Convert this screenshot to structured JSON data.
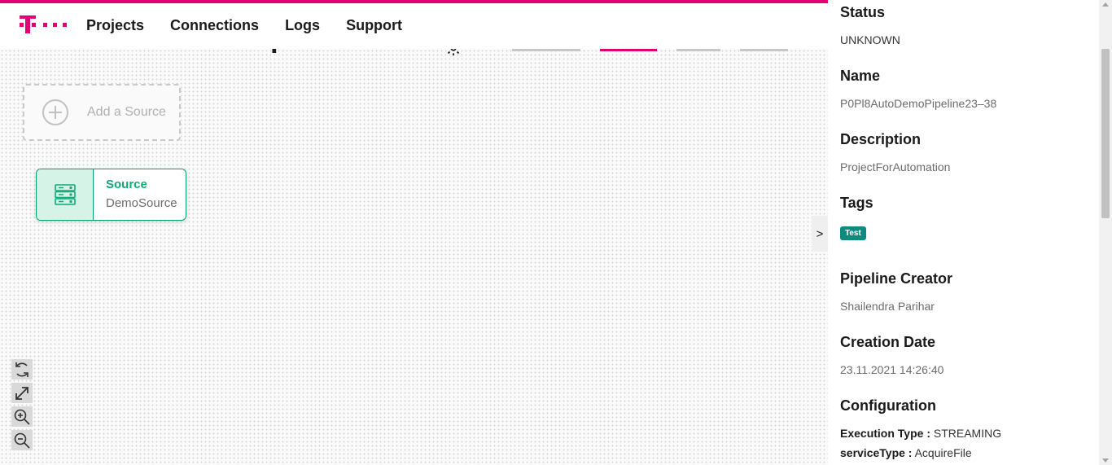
{
  "header": {
    "nav": [
      "Projects",
      "Connections",
      "Logs",
      "Support"
    ]
  },
  "pipeline": {
    "title": "P0Pl8AutoDemoPipeline23–...",
    "settings_icon": "gear-icon"
  },
  "canvas": {
    "add_source_label": "Add a Source",
    "add_source_icon": "plus-circle-icon",
    "node": {
      "type": "Source",
      "name": "DemoSource",
      "icon": "server-icon",
      "accent": "#00a36e"
    },
    "collapse_glyph": ">",
    "controls": [
      "refresh-icon",
      "fit-icon",
      "zoom-in-icon",
      "zoom-out-icon"
    ]
  },
  "details": {
    "status": {
      "label": "Status",
      "value": "UNKNOWN"
    },
    "name": {
      "label": "Name",
      "value": "P0Pl8AutoDemoPipeline23–38"
    },
    "description": {
      "label": "Description",
      "value": "ProjectForAutomation"
    },
    "tags": {
      "label": "Tags",
      "items": [
        "Test"
      ],
      "color": "#0f8a7e"
    },
    "creator": {
      "label": "Pipeline Creator",
      "value": "Shailendra Parihar"
    },
    "creation_date": {
      "label": "Creation Date",
      "value": "23.11.2021 14:26:40"
    },
    "configuration": {
      "label": "Configuration",
      "execution_type_key": "Execution Type :",
      "execution_type_value": "STREAMING",
      "service_type_key": "serviceType :",
      "service_type_value": "AcquireFile"
    }
  },
  "brand": {
    "accent": "#e20074"
  }
}
